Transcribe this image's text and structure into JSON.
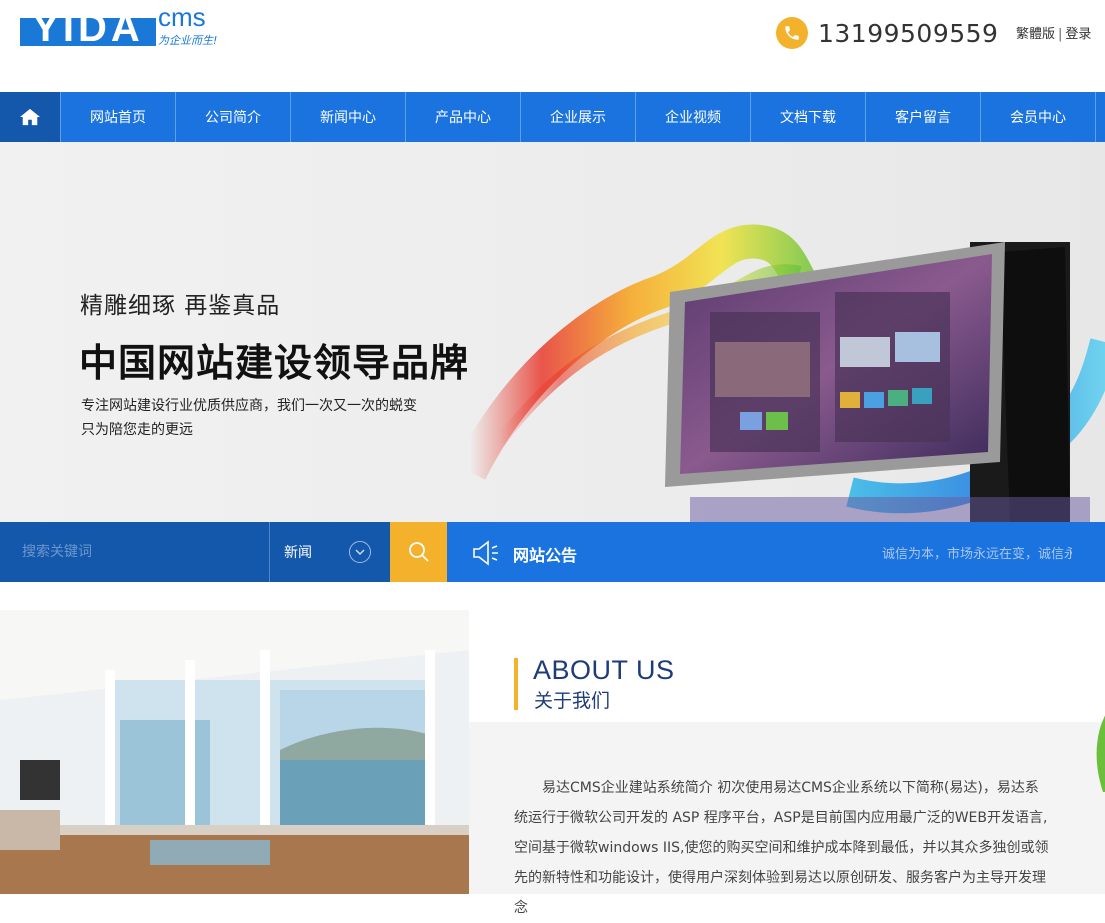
{
  "header": {
    "logo_text": "YIDA",
    "logo_cms": "cms",
    "logo_slogan": "为企业而生!",
    "phone": "13199509559",
    "links": [
      "繁體版",
      "登录"
    ],
    "links_separator": "|"
  },
  "nav": {
    "home_icon": "home-icon",
    "items": [
      "网站首页",
      "公司简介",
      "新闻中心",
      "产品中心",
      "企业展示",
      "企业视频",
      "文档下载",
      "客户留言",
      "会员中心"
    ]
  },
  "banner": {
    "subtitle": "精雕细琢 再鉴真品",
    "title": "中国网站建设领导品牌",
    "desc_line1": "专注网站建设行业优质供应商，我们一次又一次的蜕变",
    "desc_line2": "只为陪您走的更远"
  },
  "search": {
    "placeholder": "搜索关键词",
    "select_value": "新闻",
    "notice_title": "网站公告",
    "notice_text": "诚信为本，市场永远在变，诚信永远不变"
  },
  "about": {
    "title_en": "ABOUT US",
    "title_cn": "关于我们",
    "text": "易达CMS企业建站系统简介 初次使用易达CMS企业系统以下简称(易达)，易达系统运行于微软公司开发的 ASP 程序平台，ASP是目前国内应用最广泛的WEB开发语言,空间基于微软windows IIS,使您的购买空间和维护成本降到最低，并以其众多独创或领先的新特性和功能设计，使得用户深刻体验到易达以原创研发、服务客户为主导开发理念"
  },
  "colors": {
    "primary": "#1a73de",
    "primary_dark": "#1458ab",
    "accent": "#f4b12b",
    "heading": "#1f3c7a"
  }
}
